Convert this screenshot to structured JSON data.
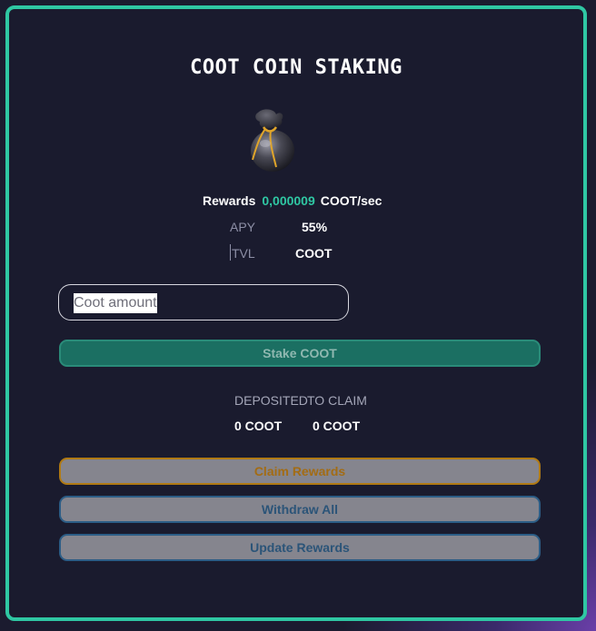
{
  "app": {
    "title": "COOT COIN STAKING",
    "icon": "coin-bag-icon"
  },
  "stats": {
    "rewards_label": "Rewards",
    "rewards_value": "0,000009",
    "rewards_unit": "COOT/sec",
    "apy_label": "APY",
    "apy_value": "55%",
    "tvl_label": "TVL",
    "tvl_value": "COOT"
  },
  "stake": {
    "input_placeholder": "Coot amount",
    "input_value": "",
    "button_label": "Stake COOT"
  },
  "balances": {
    "deposited_label": "DEPOSITED",
    "to_claim_label": "TO CLAIM",
    "deposited_value": "0 COOT",
    "to_claim_value": "0 COOT"
  },
  "actions": {
    "claim_label": "Claim Rewards",
    "withdraw_label": "Withdraw All",
    "update_label": "Update Rewards"
  },
  "colors": {
    "accent": "#2fc7a3",
    "card_bg": "#1a1b2e",
    "stake_button": "#1b6f62",
    "claim_border": "#b07a14",
    "secondary_border": "#2c5d86"
  }
}
